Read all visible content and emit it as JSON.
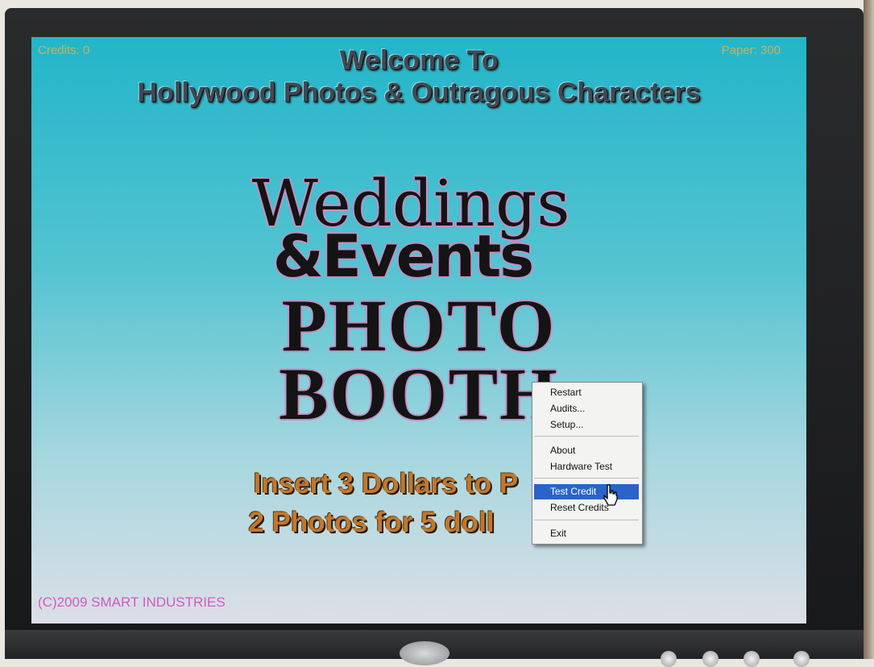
{
  "screen": {
    "credits_text": "Credits: 0",
    "paper_text": "Paper: 300",
    "welcome_line1": "Welcome To",
    "welcome_line2": "Hollywood Photos & Outragous Characters",
    "logo": {
      "line1": "Weddings",
      "line2": "&Events",
      "line3": "PHOTO",
      "line4": "BOOTH"
    },
    "promo_line1": "Insert 3 Dollars to P",
    "promo_line2": "2 Photos for 5 doll",
    "copyright": "(C)2009 SMART INDUSTRIES"
  },
  "context_menu": {
    "items": [
      {
        "label": "Restart"
      },
      {
        "label": "Audits..."
      },
      {
        "label": "Setup..."
      },
      {
        "label": "About"
      },
      {
        "label": "Hardware Test"
      },
      {
        "label": "Test Credit"
      },
      {
        "label": "Reset Credits"
      },
      {
        "label": "Exit"
      }
    ],
    "selected": "Test Credit"
  },
  "colors": {
    "screen_top": "#22b5c9",
    "screen_bottom": "#dcdfe6",
    "credits_text": "#c9b25b",
    "welcome_text": "#3f4a57",
    "promo_text": "#c0782e",
    "copyright_text": "#d05ac3",
    "menu_highlight": "#2a64c8"
  },
  "icons": [
    "mouse-pointer-icon",
    "power-button"
  ]
}
